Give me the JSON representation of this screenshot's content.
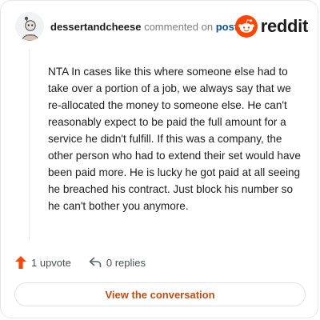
{
  "header": {
    "username": "dessertandcheese",
    "action_text": "commented on",
    "post_link": "post",
    "brand_name": "reddit",
    "brand_color": "#ff4500"
  },
  "comment": {
    "body": "NTA In cases like this where someone else had to take over a portion of a job, we always say that we re-allocated the money to someone else. He can't reasonably expect to be paid the full amount for a service he didn't fulfill. If this was a company, the other person who had to extend their set would have been paid more. He is lucky he got paid at all seeing he breached his contract. Just block his number so he can't bother you anymore."
  },
  "actions": {
    "upvote_label": "1 upvote",
    "replies_label": "0 replies",
    "upvote_color": "#ff4500"
  },
  "cta": {
    "label": "View the conversation",
    "color": "#c94a0c"
  },
  "icons": [
    "avatar-icon",
    "reddit-logo-icon",
    "upvote-arrow-icon",
    "reply-arrow-icon"
  ]
}
